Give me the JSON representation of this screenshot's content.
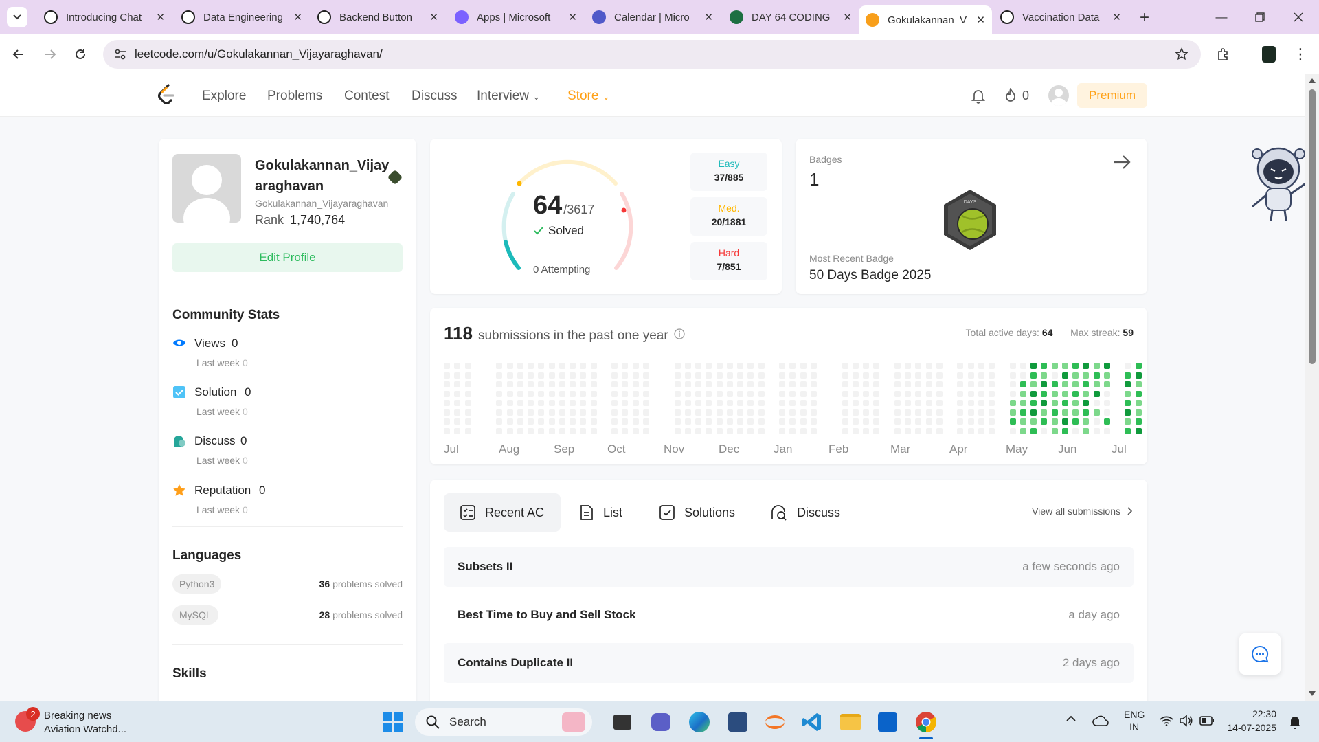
{
  "browser": {
    "tabs": [
      {
        "title": "Introducing Chat",
        "icon": "chatgpt-icon"
      },
      {
        "title": "Data Engineering",
        "icon": "chatgpt-icon"
      },
      {
        "title": "Backend Button",
        "icon": "chatgpt-icon"
      },
      {
        "title": "Apps | Microsoft",
        "icon": "copilot-icon"
      },
      {
        "title": "Calendar | Micro",
        "icon": "teams-icon"
      },
      {
        "title": "DAY 64 CODING",
        "icon": "excel-icon"
      },
      {
        "title": "Gokulakannan_V",
        "icon": "leetcode-icon"
      },
      {
        "title": "Vaccination Data",
        "icon": "chatgpt-icon"
      }
    ],
    "url": "leetcode.com/u/Gokulakannan_Vijayaraghavan/"
  },
  "nav": {
    "links": [
      "Explore",
      "Problems",
      "Contest",
      "Discuss",
      "Interview",
      "Store"
    ],
    "streak": "0",
    "premium": "Premium"
  },
  "profile": {
    "name_line1": "Gokulakannan_Vijay",
    "name_line2": "araghavan",
    "username": "Gokulakannan_Vijayaraghavan",
    "rank_label": "Rank",
    "rank_value": "1,740,764",
    "edit": "Edit Profile",
    "community_title": "Community Stats",
    "stats": [
      {
        "label": "Views",
        "value": "0",
        "lw_label": "Last week",
        "lw_value": "0",
        "icon": "eye-icon"
      },
      {
        "label": "Solution",
        "value": "0",
        "lw_label": "Last week",
        "lw_value": "0",
        "icon": "checkbox-icon"
      },
      {
        "label": "Discuss",
        "value": "0",
        "lw_label": "Last week",
        "lw_value": "0",
        "icon": "discuss-icon"
      },
      {
        "label": "Reputation",
        "value": "0",
        "lw_label": "Last week",
        "lw_value": "0",
        "icon": "star-icon"
      }
    ],
    "languages_title": "Languages",
    "languages": [
      {
        "name": "Python3",
        "count": "36",
        "suffix": "problems solved"
      },
      {
        "name": "MySQL",
        "count": "28",
        "suffix": "problems solved"
      }
    ],
    "skills_title": "Skills"
  },
  "progress": {
    "solved": "64",
    "total": "/3617",
    "solved_label": "Solved",
    "attempting": "0 Attempting",
    "easy_label": "Easy",
    "easy_value": "37/885",
    "med_label": "Med.",
    "med_value": "20/1881",
    "hard_label": "Hard",
    "hard_value": "7/851",
    "easy_color": "#1cbaba",
    "med_color": "#ffb700",
    "hard_color": "#f63737"
  },
  "badges": {
    "label": "Badges",
    "count": "1",
    "badge_text": "DAYS",
    "recent_label": "Most Recent Badge",
    "recent_name": "50 Days Badge 2025"
  },
  "calendar": {
    "count": "118",
    "label": "submissions in the past one year",
    "active_label": "Total active days:",
    "active_value": "64",
    "streak_label": "Max streak:",
    "streak_value": "59",
    "months": [
      "Jul",
      "Aug",
      "Sep",
      "Oct",
      "Nov",
      "Dec",
      "Jan",
      "Feb",
      "Mar",
      "Apr",
      "May",
      "Jun",
      "Jul"
    ]
  },
  "recent": {
    "tabs": [
      "Recent AC",
      "List",
      "Solutions",
      "Discuss"
    ],
    "view_all": "View all submissions",
    "items": [
      {
        "title": "Subsets II",
        "time": "a few seconds ago"
      },
      {
        "title": "Best Time to Buy and Sell Stock",
        "time": "a day ago"
      },
      {
        "title": "Contains Duplicate II",
        "time": "2 days ago"
      }
    ]
  },
  "taskbar": {
    "news_badge": "2",
    "news_title": "Breaking news",
    "news_sub": "Aviation Watchd...",
    "search": "Search",
    "lang_top": "ENG",
    "lang_bottom": "IN",
    "time": "22:30",
    "date": "14-07-2025"
  }
}
